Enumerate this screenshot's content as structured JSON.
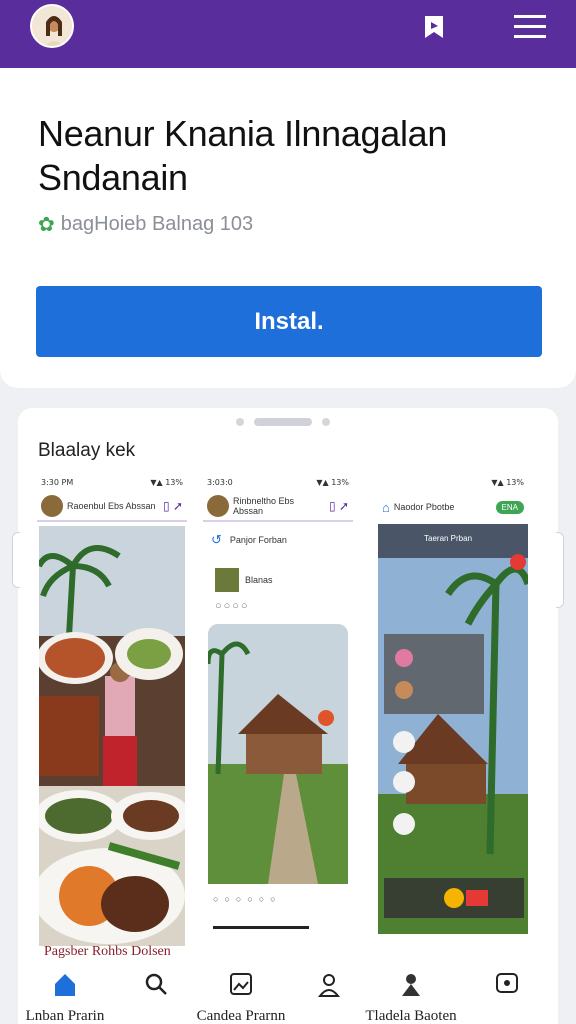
{
  "header": {
    "avatar_icon": "profile-avatar-icon",
    "bookmark_icon": "bookmark-icon",
    "menu_icon": "hamburger-menu-icon",
    "brand_color": "#5a2d9c"
  },
  "app": {
    "title": "Neanur Knania Ilnnagalan Sndanain",
    "subtitle": "bagHoieb Balnag 103",
    "install_label": "Instal.",
    "install_color": "#1e6fd9"
  },
  "gallery": {
    "section_label": "Blaalay kek",
    "screens": [
      {
        "status_time": "3:30 PM",
        "status_right": "▼▲ 13%",
        "app_title": "Raoenbul Ebs Abssan",
        "caption": "Pagsber Rohbs Dolsen"
      },
      {
        "status_time": "3:03:0",
        "status_right": "▼▲ 13%",
        "app_title": "Rinbneltho Ebs Abssan",
        "sub_title": "Panjor Forban",
        "row_label": "Blanas"
      },
      {
        "status_time": "",
        "status_right": "▼▲ 13%",
        "app_title": "Naodor Pbotbe",
        "badge": "ENA",
        "banner": "Taeran Prban"
      }
    ]
  },
  "tabbar": {
    "tabs": [
      {
        "icon": "home-icon",
        "label": "Lnban Prarin"
      },
      {
        "icon": "search-icon",
        "label": ""
      },
      {
        "icon": "photo-icon",
        "label": "Candea Prarnn"
      },
      {
        "icon": "person-icon",
        "label": ""
      },
      {
        "icon": "user-icon",
        "label": "Tladela Baoten"
      },
      {
        "icon": "chat-icon",
        "label": ""
      }
    ]
  }
}
